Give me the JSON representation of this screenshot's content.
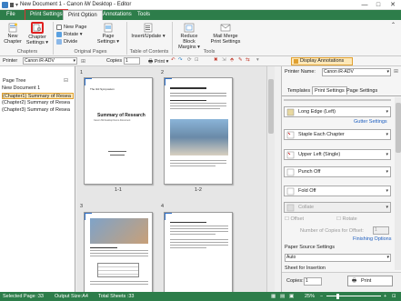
{
  "window": {
    "title": "New Document 1 - Canon iW Desktop - Editor",
    "minimize": "—",
    "maximize": "□",
    "close": "✕"
  },
  "tabs": [
    "File",
    "Print Settings",
    "Print Option",
    "Annotations",
    "Tools"
  ],
  "ribbon": {
    "new_chapter": "New Chapter",
    "chapter_settings": "Chapter Settings",
    "chapters_group": "Chapters",
    "new_page": "New Page",
    "rotate": "Rotate",
    "divide": "Divide",
    "page_settings": "Page Settings",
    "original_pages_group": "Original Pages",
    "insert_update": "Insert/Update",
    "toc_group": "Table of Contents",
    "reduce_block_margins": "Reduce Block Margins",
    "mail_merge": "Mail Merge Print Settings",
    "tools_group": "Tools"
  },
  "toolbar": {
    "printer_label": "Printer",
    "printer_value": "Canon iR-ADV",
    "copies_label": "Copies",
    "copies_value": "1",
    "print_label": "Print",
    "display_annotations": "Display Annotations"
  },
  "page_tree": {
    "title": "Page Tree",
    "items": [
      "New Document 1",
      "(Chapter1) Summary of Resea",
      "(Chapter2) Summary of Resea",
      "(Chapter3) Summary of Resea"
    ]
  },
  "pages": {
    "numbers": [
      "1",
      "2",
      "3",
      "4"
    ],
    "labels": [
      "1-1",
      "1-2"
    ],
    "page1_header": "The 3rd Symposium",
    "page1_title": "Summary of Research",
    "page1_sub": "Canon iW Desktop Demo Document"
  },
  "right_panel": {
    "printer_name_label": "Printer Name:",
    "printer_name_value": "Canon iR-ADV",
    "tabs": [
      "Templates",
      "Print Settings",
      "Page Settings"
    ],
    "print_style": "Long Edge (Left)",
    "gutter_settings": "Gutter Settings",
    "staple": "Staple Each Chapter",
    "staple_position": "Upper Left (Single)",
    "punch": "Punch Off",
    "fold": "Fold Off",
    "collate": "Collate",
    "offset": "Offset",
    "rotate": "Rotate",
    "offset_copies_label": "Number of Copies for Offset:",
    "offset_copies_value": "1",
    "finishing_options": "Finishing Options",
    "paper_source_label": "Paper Source Settings",
    "paper_source_value": "Auto",
    "sheet_insertion_label": "Sheet for Insertion",
    "copies_label": "Copies:",
    "copies_value": "1",
    "print_button": "Print"
  },
  "status": {
    "selected_page": "Selected Page :33",
    "output_size": "Output Size:A4",
    "total_sheets": "Total Sheets :33",
    "zoom": "25%"
  },
  "colors": {
    "accent": "#2d7d4a",
    "highlight_box": "#e02020",
    "selection": "#fde8b8"
  }
}
